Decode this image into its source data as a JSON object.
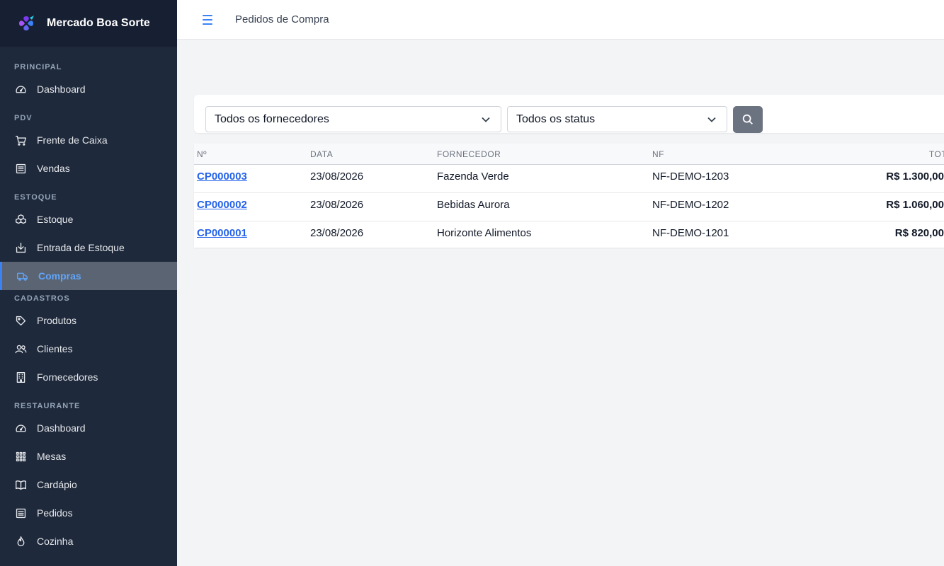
{
  "brand": {
    "name": "Mercado Boa Sorte"
  },
  "sidebar": {
    "sections": [
      {
        "label": "PRINCIPAL",
        "items": [
          {
            "label": "Dashboard",
            "icon": "dashboard-gauge-icon"
          }
        ]
      },
      {
        "label": "PDV",
        "items": [
          {
            "label": "Frente de Caixa",
            "icon": "cart-icon"
          },
          {
            "label": "Vendas",
            "icon": "list-icon"
          }
        ]
      },
      {
        "label": "ESTOQUE",
        "items": [
          {
            "label": "Estoque",
            "icon": "boxes-icon"
          },
          {
            "label": "Entrada de Estoque",
            "icon": "download-box-icon"
          },
          {
            "label": "Compras",
            "icon": "truck-icon",
            "active": true
          }
        ]
      },
      {
        "label": "CADASTROS",
        "items": [
          {
            "label": "Produtos",
            "icon": "tag-icon"
          },
          {
            "label": "Clientes",
            "icon": "people-icon"
          },
          {
            "label": "Fornecedores",
            "icon": "building-icon"
          }
        ]
      },
      {
        "label": "RESTAURANTE",
        "items": [
          {
            "label": "Dashboard",
            "icon": "dashboard-gauge-icon"
          },
          {
            "label": "Mesas",
            "icon": "grid-icon"
          },
          {
            "label": "Cardápio",
            "icon": "book-icon"
          },
          {
            "label": "Pedidos",
            "icon": "list-icon"
          },
          {
            "label": "Cozinha",
            "icon": "fire-icon"
          }
        ]
      }
    ]
  },
  "header": {
    "title": "Pedidos de Compra"
  },
  "filters": {
    "supplier_select": "Todos os fornecedores",
    "status_select": "Todos os status"
  },
  "table": {
    "headers": {
      "num": "Nº",
      "date": "DATA",
      "supplier": "FORNECEDOR",
      "nf": "NF",
      "total": "TOTAL"
    },
    "rows": [
      {
        "num": "CP000003",
        "date": "23/08/2026",
        "supplier": "Fazenda Verde",
        "nf": "NF-DEMO-1203",
        "total": "R$ 1.300,00"
      },
      {
        "num": "CP000002",
        "date": "23/08/2026",
        "supplier": "Bebidas Aurora",
        "nf": "NF-DEMO-1202",
        "total": "R$ 1.060,00"
      },
      {
        "num": "CP000001",
        "date": "23/08/2026",
        "supplier": "Horizonte Alimentos",
        "nf": "NF-DEMO-1201",
        "total": "R$ 820,00"
      }
    ]
  },
  "colors": {
    "sidebar_bg": "#1e293b",
    "accent": "#3b82f6",
    "active_bg": "#5b6472"
  }
}
